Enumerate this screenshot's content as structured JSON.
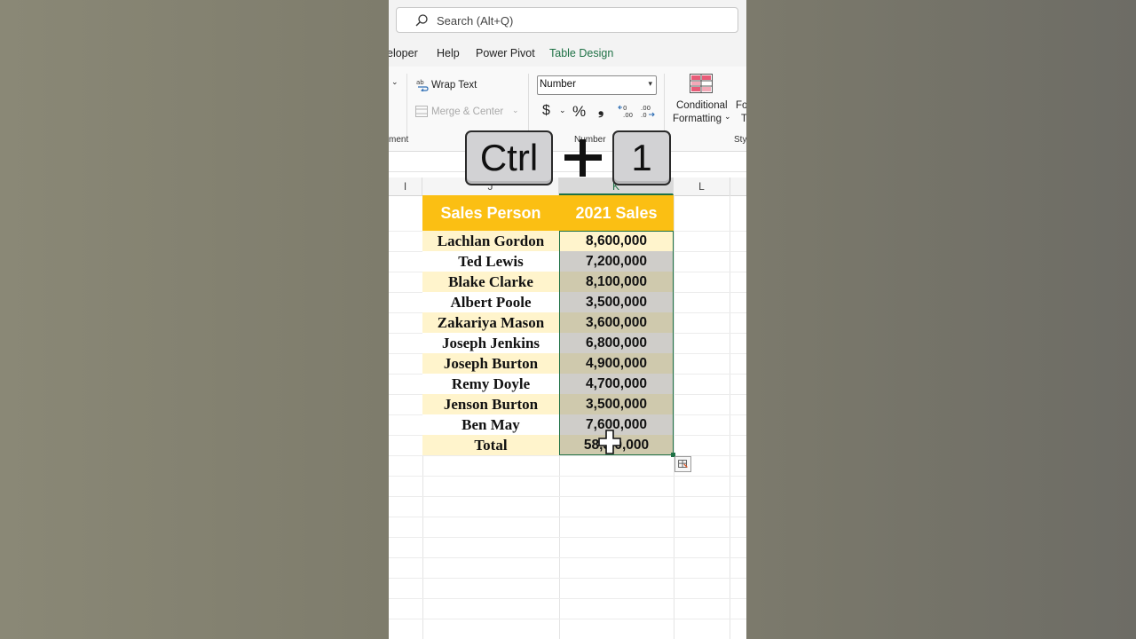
{
  "search": {
    "placeholder": "Search (Alt+Q)"
  },
  "menu_tabs": [
    "eloper",
    "Help",
    "Power Pivot",
    "Table Design"
  ],
  "ribbon": {
    "wrap_text": "Wrap Text",
    "merge_center": "Merge & Center",
    "number_format": "Number",
    "currency": "$",
    "percent": "%",
    "comma": "❟",
    "cond_line1": "Conditional",
    "cond_line2": "Formatting",
    "fo_cut": "Fo",
    "t_cut": "T",
    "group_alignment": "ment",
    "group_number": "Number",
    "group_styles": "Sty"
  },
  "columns": {
    "left": "I",
    "sel_left": "J",
    "sel": "K",
    "right": "L"
  },
  "table": {
    "header": {
      "col1": "Sales Person",
      "col2": "2021 Sales"
    },
    "rows": [
      {
        "name": "Lachlan Gordon",
        "value": "8,600,000"
      },
      {
        "name": "Ted Lewis",
        "value": "7,200,000"
      },
      {
        "name": "Blake Clarke",
        "value": "8,100,000"
      },
      {
        "name": "Albert Poole",
        "value": "3,500,000"
      },
      {
        "name": "Zakariya Mason",
        "value": "3,600,000"
      },
      {
        "name": "Joseph Jenkins",
        "value": "6,800,000"
      },
      {
        "name": "Joseph Burton",
        "value": "4,900,000"
      },
      {
        "name": "Remy Doyle",
        "value": "4,700,000"
      },
      {
        "name": "Jenson Burton",
        "value": "3,500,000"
      },
      {
        "name": "Ben May",
        "value": "7,600,000"
      },
      {
        "name": "Total",
        "value": "58,5 0,000"
      }
    ]
  },
  "overlay": {
    "key1": "Ctrl",
    "key2": "1"
  },
  "colors": {
    "header": "#fbbf13",
    "accent": "#1e7145",
    "band": "#fff4cc"
  }
}
